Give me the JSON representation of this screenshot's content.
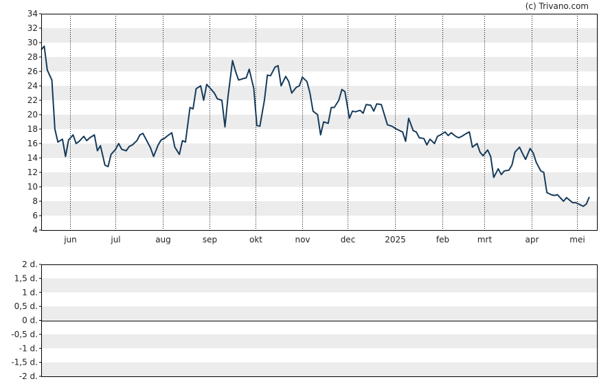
{
  "copyright": "(c) Trivano.com",
  "colors": {
    "line": "#143a5a",
    "band": "#ececec",
    "frame": "#000000",
    "grid": "#000000"
  },
  "chart_data": [
    {
      "type": "line",
      "title": "",
      "xlabel": "",
      "ylabel": "",
      "ylim": [
        4,
        34
      ],
      "y_ticks": [
        "34",
        "32",
        "30",
        "28",
        "26",
        "24",
        "22",
        "20",
        "18",
        "16",
        "14",
        "12",
        "10",
        "8",
        "6",
        "4"
      ],
      "x_ticks": [
        "jun",
        "jul",
        "aug",
        "sep",
        "okt",
        "nov",
        "dec",
        "2025",
        "feb",
        "mrt",
        "apr",
        "mei"
      ],
      "grid": "vertical dotted at month starts, alternating horizontal bands",
      "x": [
        "2024-05-13",
        "2024-05-15",
        "2024-05-17",
        "2024-05-20",
        "2024-05-22",
        "2024-05-24",
        "2024-05-27",
        "2024-05-29",
        "2024-05-31",
        "2024-06-03",
        "2024-06-05",
        "2024-06-07",
        "2024-06-10",
        "2024-06-12",
        "2024-06-14",
        "2024-06-17",
        "2024-06-19",
        "2024-06-21",
        "2024-06-24",
        "2024-06-26",
        "2024-06-28",
        "2024-07-01",
        "2024-07-03",
        "2024-07-05",
        "2024-07-08",
        "2024-07-10",
        "2024-07-12",
        "2024-07-15",
        "2024-07-17",
        "2024-07-19",
        "2024-07-22",
        "2024-07-24",
        "2024-07-26",
        "2024-07-29",
        "2024-07-31",
        "2024-08-02",
        "2024-08-05",
        "2024-08-07",
        "2024-08-09",
        "2024-08-12",
        "2024-08-14",
        "2024-08-16",
        "2024-08-19",
        "2024-08-21",
        "2024-08-23",
        "2024-08-26",
        "2024-08-28",
        "2024-08-30",
        "2024-09-02",
        "2024-09-04",
        "2024-09-06",
        "2024-09-09",
        "2024-09-11",
        "2024-09-13",
        "2024-09-16",
        "2024-09-18",
        "2024-09-20",
        "2024-09-23",
        "2024-09-25",
        "2024-09-27",
        "2024-09-30",
        "2024-10-02",
        "2024-10-04",
        "2024-10-07",
        "2024-10-09",
        "2024-10-11",
        "2024-10-14",
        "2024-10-16",
        "2024-10-18",
        "2024-10-21",
        "2024-10-23",
        "2024-10-25",
        "2024-10-28",
        "2024-10-30",
        "2024-11-01",
        "2024-11-04",
        "2024-11-06",
        "2024-11-08",
        "2024-11-11",
        "2024-11-13",
        "2024-11-15",
        "2024-11-18",
        "2024-11-20",
        "2024-11-22",
        "2024-11-25",
        "2024-11-27",
        "2024-11-29",
        "2024-12-02",
        "2024-12-04",
        "2024-12-06",
        "2024-12-09",
        "2024-12-11",
        "2024-12-13",
        "2024-12-16",
        "2024-12-18",
        "2024-12-20",
        "2024-12-23",
        "2024-12-27",
        "2024-12-30",
        "2025-01-02",
        "2025-01-06",
        "2025-01-08",
        "2025-01-10",
        "2025-01-13",
        "2025-01-15",
        "2025-01-17",
        "2025-01-20",
        "2025-01-22",
        "2025-01-24",
        "2025-01-27",
        "2025-01-29",
        "2025-01-31",
        "2025-02-03",
        "2025-02-05",
        "2025-02-07",
        "2025-02-10",
        "2025-02-12",
        "2025-02-14",
        "2025-02-17",
        "2025-02-19",
        "2025-02-21",
        "2025-02-24",
        "2025-02-26",
        "2025-02-28",
        "2025-03-03",
        "2025-03-05",
        "2025-03-07",
        "2025-03-10",
        "2025-03-12",
        "2025-03-14",
        "2025-03-17",
        "2025-03-19",
        "2025-03-21",
        "2025-03-24",
        "2025-03-26",
        "2025-03-28",
        "2025-03-31",
        "2025-04-02",
        "2025-04-04",
        "2025-04-07",
        "2025-04-09",
        "2025-04-11",
        "2025-04-14",
        "2025-04-16",
        "2025-04-18",
        "2025-04-22",
        "2025-04-24",
        "2025-04-28",
        "2025-04-30",
        "2025-05-02",
        "2025-05-05",
        "2025-05-07",
        "2025-05-09",
        "2025-05-12",
        "2025-05-14"
      ],
      "series": [
        {
          "values": [
            29.0,
            29.5,
            26.2,
            24.8,
            18.0,
            16.2,
            16.6,
            14.2,
            16.5,
            17.2,
            16.0,
            16.3,
            17.0,
            16.4,
            16.8,
            17.2,
            15.0,
            15.7,
            13.0,
            12.8,
            14.5,
            15.2,
            16.0,
            15.2,
            15.0,
            15.6,
            15.8,
            16.4,
            17.2,
            17.4,
            16.2,
            15.4,
            14.2,
            15.8,
            16.5,
            16.7,
            17.2,
            17.5,
            15.5,
            14.5,
            16.4,
            16.2,
            21.0,
            20.8,
            23.6,
            24.0,
            22.0,
            24.2,
            23.5,
            23.0,
            22.2,
            22.0,
            18.3,
            22.5,
            27.5,
            26.0,
            24.8,
            25.0,
            25.1,
            26.3,
            23.6,
            18.5,
            18.4,
            22.0,
            25.5,
            25.4,
            26.6,
            26.8,
            24.0,
            25.3,
            24.6,
            23.0,
            23.8,
            24.0,
            25.2,
            24.6,
            23.0,
            20.5,
            20.0,
            17.2,
            19.0,
            18.8,
            21.0,
            21.0,
            22.0,
            23.5,
            23.2,
            19.5,
            20.5,
            20.4,
            20.6,
            20.2,
            21.4,
            21.3,
            20.5,
            21.5,
            21.4,
            18.6,
            18.4,
            18.0,
            17.6,
            16.3,
            19.5,
            17.8,
            17.6,
            16.8,
            16.7,
            15.8,
            16.6,
            16.0,
            17.0,
            17.2,
            17.6,
            17.1,
            17.5,
            17.0,
            16.8,
            17.0,
            17.4,
            17.6,
            15.5,
            16.0,
            14.8,
            14.3,
            15.1,
            14.2,
            11.3,
            12.5,
            11.7,
            12.2,
            12.3,
            13.0,
            14.8,
            15.5,
            14.6,
            13.8,
            15.3,
            14.7,
            13.4,
            12.2,
            12.0,
            9.2,
            8.9,
            8.8,
            8.9,
            8.0,
            8.5,
            7.8,
            7.8,
            7.6,
            7.3,
            7.6,
            8.6
          ]
        }
      ]
    },
    {
      "type": "line",
      "title": "",
      "xlabel": "",
      "ylabel": "",
      "ylim": [
        -2,
        2
      ],
      "y_ticks": [
        "2 d.",
        "1,5 d.",
        "1 d.",
        "0,5 d.",
        "0 d.",
        "-0,5 d.",
        "-1 d.",
        "-1,5 d.",
        "-2 d."
      ],
      "series": []
    }
  ]
}
